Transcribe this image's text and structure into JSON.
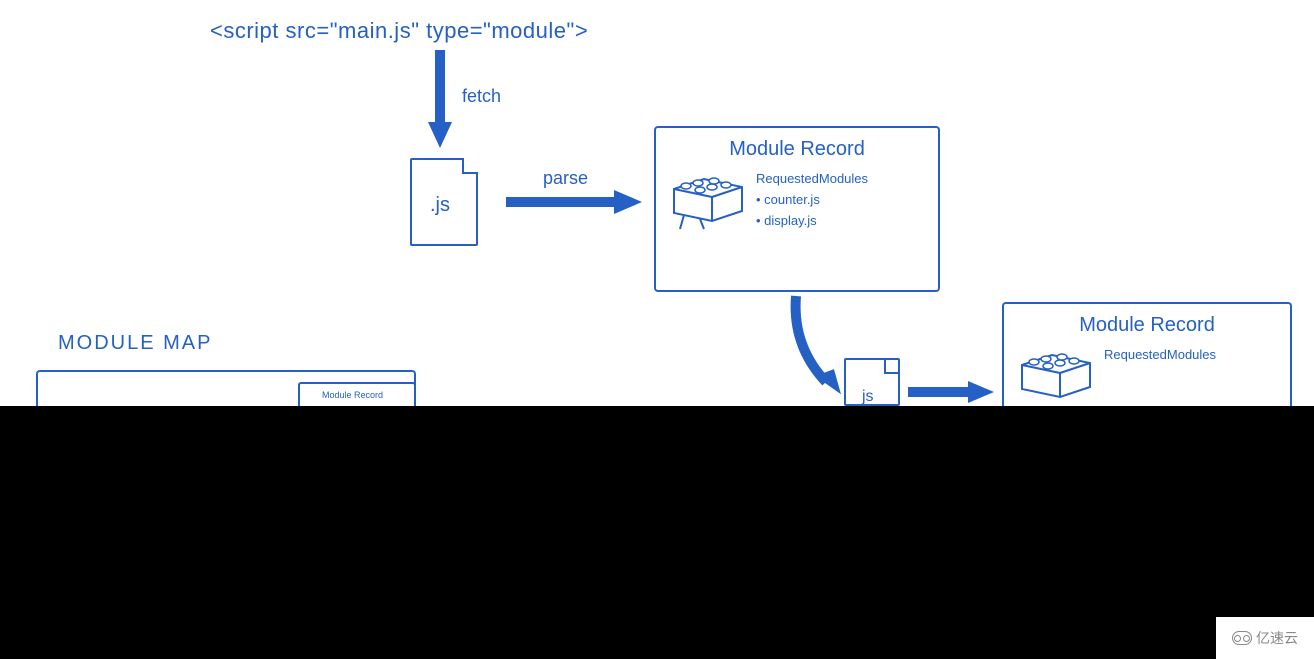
{
  "script_tag_text": "<script src=\"main.js\" type=\"module\">",
  "labels": {
    "fetch": "fetch",
    "parse": "parse",
    "module_map": "MODULE MAP",
    "mini_record": "Module Record"
  },
  "js_file": {
    "ext": ".js",
    "ext_short": "js"
  },
  "record1": {
    "title": "Module Record",
    "subtitle": "RequestedModules",
    "items": [
      "counter.js",
      "display.js"
    ]
  },
  "record2": {
    "title": "Module Record",
    "subtitle": "RequestedModules"
  },
  "watermark": "亿速云"
}
